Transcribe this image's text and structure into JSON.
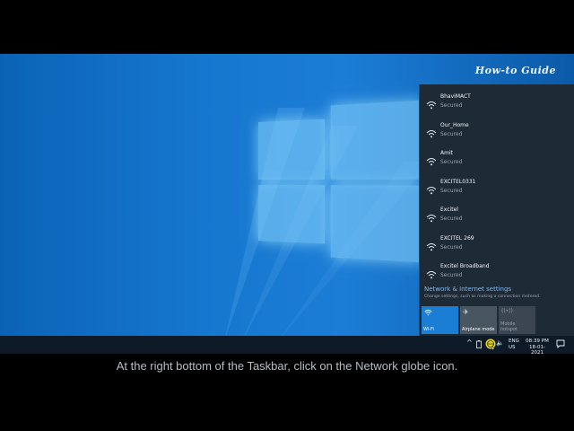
{
  "watermark": "How-to Guide",
  "networks": [
    {
      "name": "BhaviMACT",
      "status": "Secured"
    },
    {
      "name": "Our_Home",
      "status": "Secured"
    },
    {
      "name": "Amit",
      "status": "Secured"
    },
    {
      "name": "EXCITEL0331",
      "status": "Secured"
    },
    {
      "name": "Excitel",
      "status": "Secured"
    },
    {
      "name": "EXCITEL 269",
      "status": "Secured"
    },
    {
      "name": "Excitel Broadband",
      "status": "Secured"
    }
  ],
  "settings": {
    "link": "Network & Internet settings",
    "subtitle": "Change settings, such as making a connection metered."
  },
  "quick_actions": {
    "wifi": "Wi-Fi",
    "airplane": "Airplane mode",
    "hotspot_line1": "Mobile",
    "hotspot_line2": "hotspot"
  },
  "tray": {
    "lang": "ENG",
    "region": "US",
    "time": "08:39 PM",
    "date": "18-01-2021"
  },
  "caption": "At the right bottom of the Taskbar, click on the Network globe icon.",
  "colors": {
    "accent": "#1a7fd4",
    "flyout_bg": "#1f2a37",
    "highlight": "#e8d814"
  }
}
